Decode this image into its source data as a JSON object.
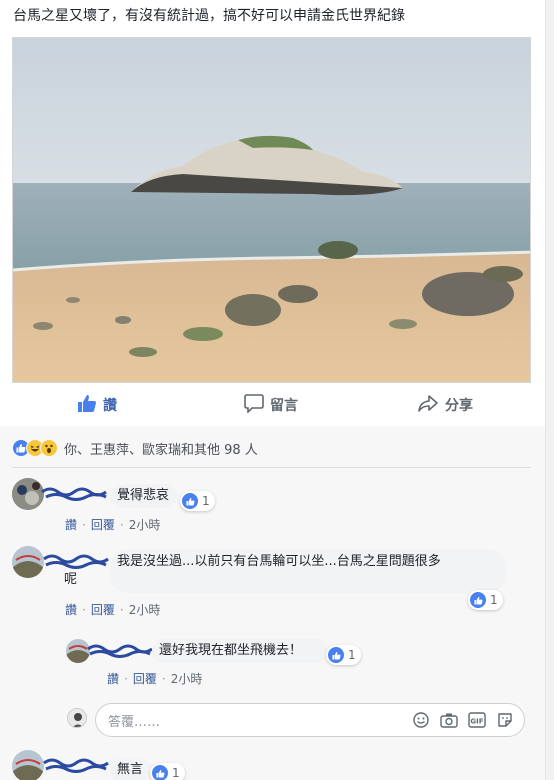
{
  "post": {
    "text": "台馬之星又壞了，有沒有統計過，搞不好可以申請金氏世界紀錄"
  },
  "actions": {
    "like": "讚",
    "comment": "留言",
    "share": "分享"
  },
  "reactions": {
    "summary": "你、王惠萍、歐家瑞和其他 98 人"
  },
  "comments": [
    {
      "text": "覺得悲哀",
      "like_count": "1",
      "like": "讚",
      "reply": "回覆",
      "time": "2小時"
    },
    {
      "text_line1": "我是沒坐過...以前只有台馬輪可以坐...台馬之星問題很多",
      "text_line2": "呢",
      "like_count": "1",
      "like": "讚",
      "reply": "回覆",
      "time": "2小時"
    },
    {
      "text": "還好我現在都坐飛機去！",
      "like_count": "1",
      "like": "讚",
      "reply": "回覆",
      "time": "2小時"
    },
    {
      "text": "無言",
      "like_count": "1"
    }
  ],
  "reply_box": {
    "placeholder": "答覆……"
  },
  "colors": {
    "brand": "#4267b2",
    "like_blue": "#4880f0",
    "link": "#385898",
    "meta_gray": "#606770"
  },
  "icons": [
    "thumbs-up-icon",
    "comment-icon",
    "share-icon",
    "haha-icon",
    "wow-icon",
    "emoji-icon",
    "camera-icon",
    "gif-icon",
    "sticker-icon"
  ]
}
